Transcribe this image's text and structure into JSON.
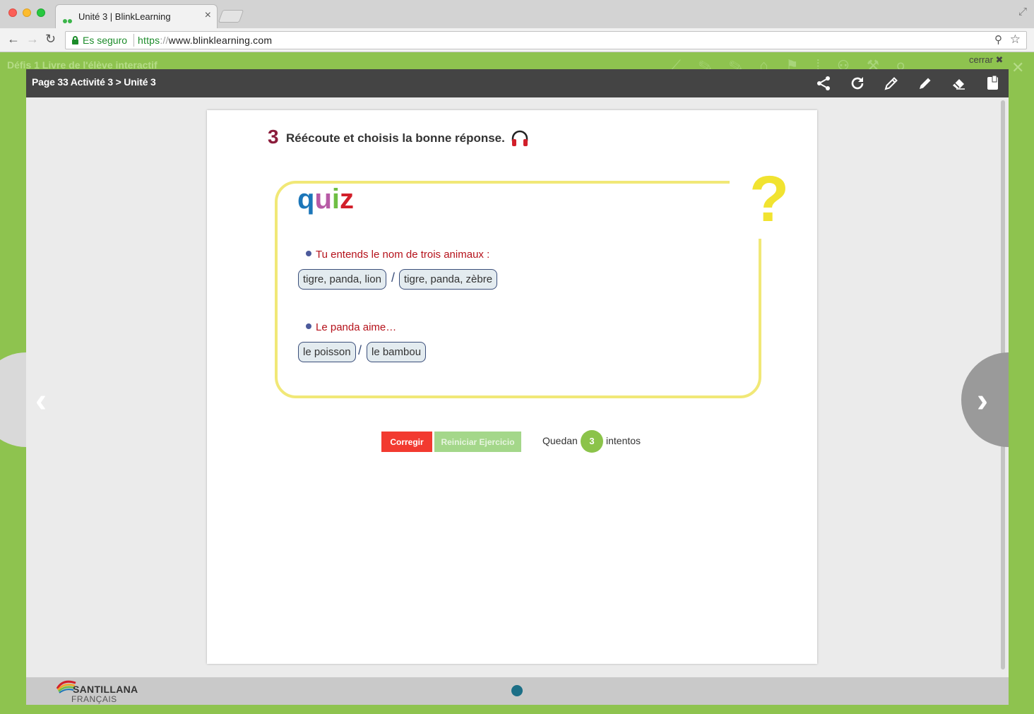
{
  "browser": {
    "tab_title": "Unité 3 | BlinkLearning",
    "tab_close": "×",
    "secure_label": "Es seguro",
    "url_scheme": "https",
    "url_slashes": "://",
    "url_host": "www.blinklearning.com"
  },
  "app": {
    "bg_title": "Défis 1 Livre de l'élève interactif",
    "cerrar_label": "cerrar ✖"
  },
  "modal": {
    "title": "Page 33 Activité 3 > Unité 3",
    "toolbar": [
      "share-icon",
      "reload-icon",
      "pencil-outline-icon",
      "pencil-icon",
      "eraser-icon",
      "notes-icon"
    ]
  },
  "activity": {
    "number": "3",
    "instruction": "Réécoute et choisis la bonne réponse.",
    "quiz_letters": [
      "q",
      "u",
      "i",
      "z"
    ],
    "quiz_colors": [
      "#1b76b9",
      "#b75aa6",
      "#6fbf44",
      "#d21f2a"
    ],
    "question_mark": "?",
    "questions": [
      {
        "text": "Tu entends le nom de trois animaux :",
        "options": [
          "tigre, panda, lion",
          "tigre, panda, zèbre"
        ],
        "separator": "/"
      },
      {
        "text": "Le panda aime…",
        "options": [
          "le poisson",
          "le bambou"
        ],
        "separator": "/"
      }
    ]
  },
  "controls": {
    "corregir": "Corregir",
    "reiniciar": "Reiniciar Ejercicio",
    "quedan": "Quedan",
    "attempts": "3",
    "intentos": "intentos"
  },
  "footer": {
    "brand": "SANTILLANA",
    "brand_sub": "FRANÇAIS"
  },
  "colors": {
    "accent_green": "#8ec34f",
    "header_dark": "#444444",
    "question_red": "#b5121b",
    "quiz_border": "#f1e877"
  }
}
